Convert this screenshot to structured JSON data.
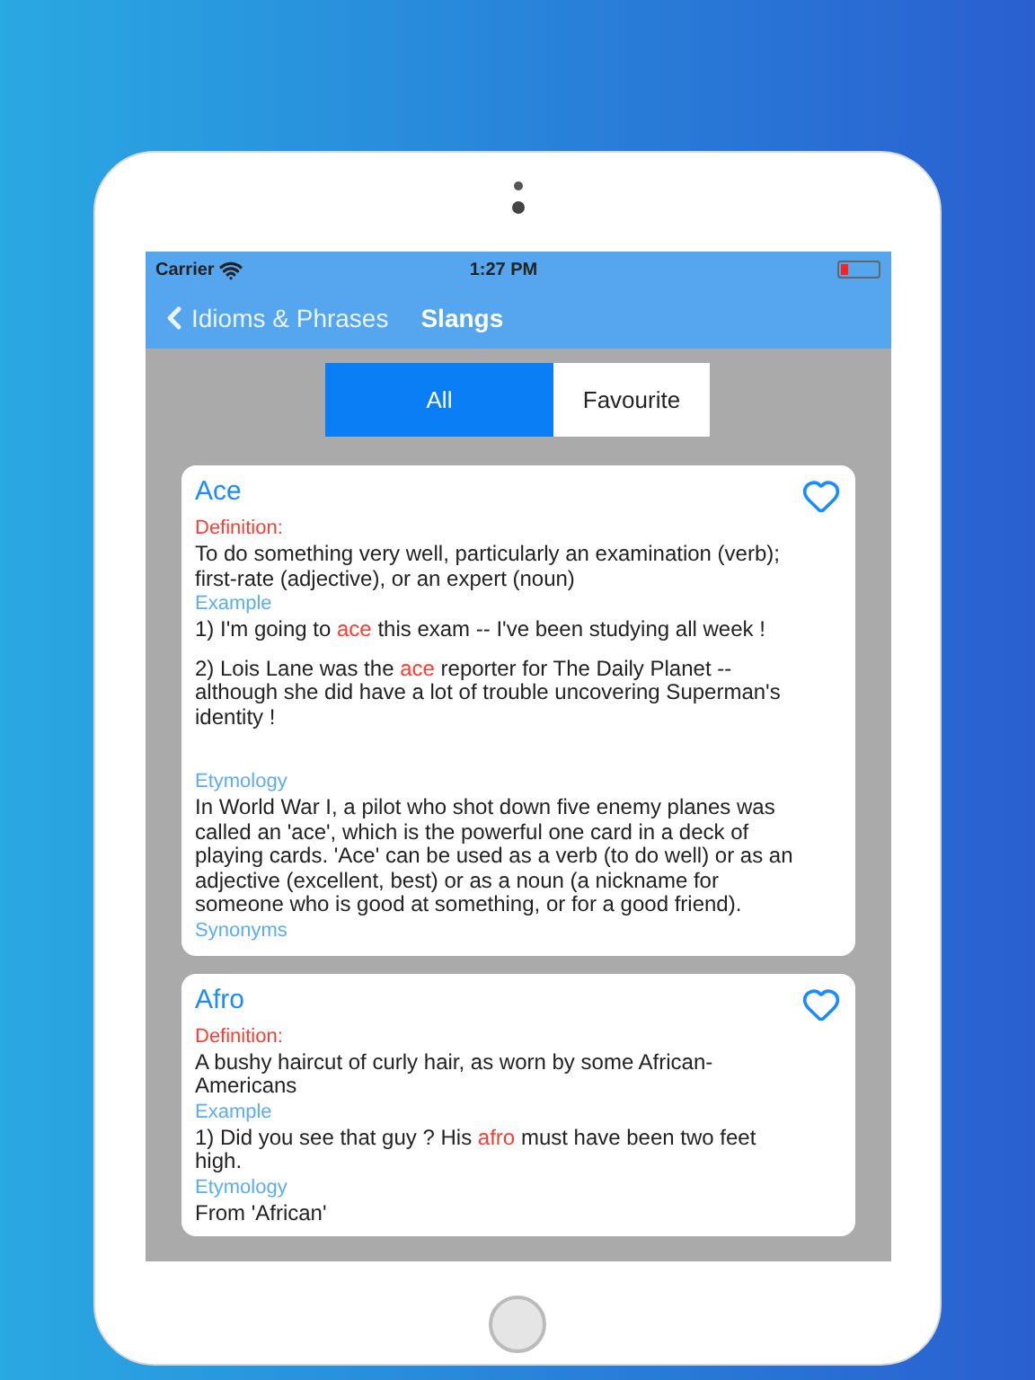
{
  "status_bar": {
    "carrier": "Carrier",
    "time": "1:27 PM"
  },
  "nav_bar": {
    "back": "Idioms & Phrases",
    "title": "Slangs"
  },
  "segments": [
    {
      "label": "All",
      "selected": true
    },
    {
      "label": "Favourite",
      "selected": false
    }
  ],
  "entries": [
    {
      "word": "Ace",
      "favourite": false,
      "sections": [
        {
          "kind": "definition",
          "label": "Definition:",
          "paragraphs": [
            [
              {
                "text": "To do something very well, particularly an examination (verb); first-rate (adjective), or an expert (noun)",
                "highlight": false
              }
            ]
          ]
        },
        {
          "kind": "example",
          "label": "Example",
          "paragraphs": [
            [
              {
                "text": "1) I'm going to ",
                "highlight": false
              },
              {
                "text": "ace",
                "highlight": true
              },
              {
                "text": " this exam -- I've been studying all week !",
                "highlight": false
              }
            ],
            [
              {
                "text": "2) Lois Lane was the ",
                "highlight": false
              },
              {
                "text": "ace",
                "highlight": true
              },
              {
                "text": " reporter for The Daily Planet -- although she did have a lot of trouble uncovering Superman's identity !",
                "highlight": false
              }
            ]
          ]
        },
        {
          "kind": "etymology",
          "label": "Etymology",
          "paragraphs": [
            [
              {
                "text": "In World War I, a pilot who shot down five enemy planes was called an 'ace', which is the powerful one card in a deck of playing cards. 'Ace' can be used as a verb (to do well) or as an adjective (excellent, best) or as a noun (a nickname for someone who is good at something, or for a good friend).",
                "highlight": false
              }
            ]
          ]
        },
        {
          "kind": "synonyms",
          "label": "Synonyms"
        }
      ]
    },
    {
      "word": "Afro",
      "favourite": false,
      "sections": [
        {
          "kind": "definition",
          "label": "Definition:",
          "paragraphs": [
            [
              {
                "text": "A bushy haircut of curly hair, as worn by some African-Americans",
                "highlight": false
              }
            ]
          ]
        },
        {
          "kind": "example",
          "label": "Example",
          "paragraphs": [
            [
              {
                "text": "1) Did you see that guy ? His ",
                "highlight": false
              },
              {
                "text": "afro",
                "highlight": true
              },
              {
                "text": " must have been two feet high.",
                "highlight": false
              }
            ]
          ]
        },
        {
          "kind": "etymology",
          "label": "Etymology",
          "paragraphs": [
            [
              {
                "text": "From 'African'",
                "highlight": false
              }
            ]
          ]
        }
      ]
    }
  ]
}
